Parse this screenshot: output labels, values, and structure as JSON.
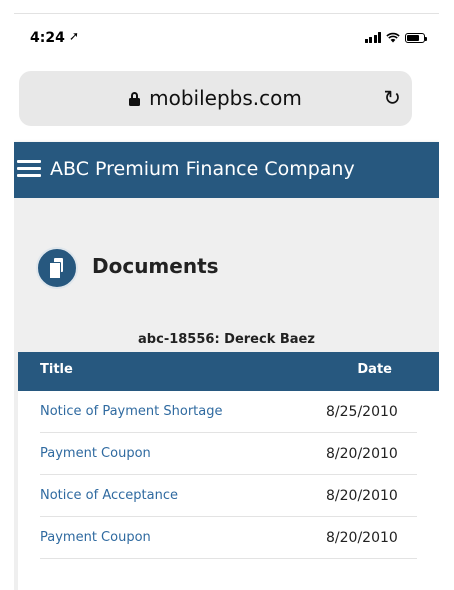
{
  "status_bar": {
    "time": "4:24"
  },
  "browser": {
    "url": "mobilepbs.com"
  },
  "header": {
    "title": "ABC Premium Finance Company"
  },
  "page": {
    "title": "Documents",
    "account": "abc-18556: Dereck Baez"
  },
  "table": {
    "columns": [
      "Title",
      "Date"
    ],
    "rows": [
      {
        "title": "Notice of Payment Shortage",
        "date": "8/25/2010"
      },
      {
        "title": "Payment Coupon",
        "date": "8/20/2010"
      },
      {
        "title": "Notice of Acceptance",
        "date": "8/20/2010"
      },
      {
        "title": "Payment Coupon",
        "date": "8/20/2010"
      }
    ]
  },
  "colors": {
    "brand": "#27587f",
    "link": "#2f6aa0",
    "background": "#efefef"
  },
  "icons": [
    "location-arrow-icon",
    "signal-icon",
    "wifi-icon",
    "battery-icon",
    "lock-icon",
    "reload-icon",
    "hamburger-icon",
    "documents-icon"
  ]
}
